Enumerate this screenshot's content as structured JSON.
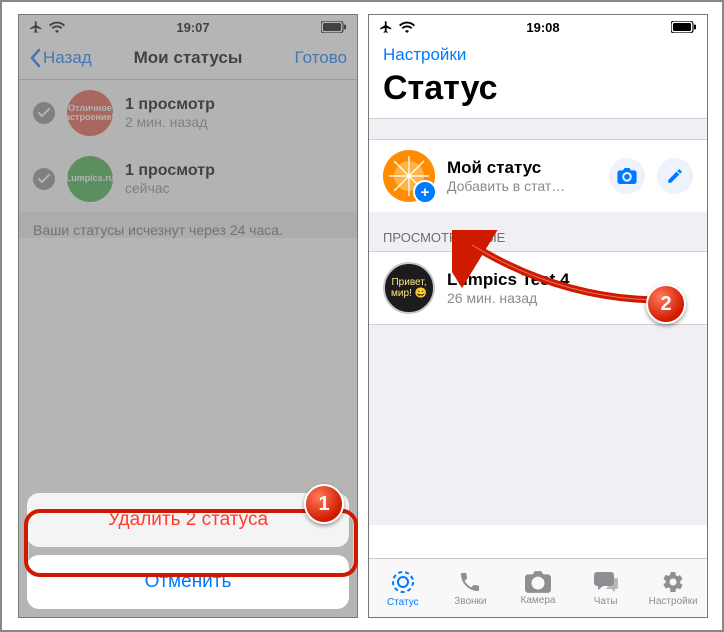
{
  "left": {
    "status_time": "19:07",
    "nav_back": "Назад",
    "nav_title": "Мои статусы",
    "nav_done": "Готово",
    "items": [
      {
        "thumb_label": "Отличное\nнастроение!!!",
        "title": "1 просмотр",
        "subtitle": "2 мин. назад"
      },
      {
        "thumb_label": "Lumpics.ru",
        "title": "1 просмотр",
        "subtitle": "сейчас"
      }
    ],
    "footer_note": "Ваши статусы исчезнут через 24 часа.",
    "sheet_delete": "Удалить 2 статуса",
    "sheet_cancel": "Отменить"
  },
  "right": {
    "status_time": "19:08",
    "settings_link": "Настройки",
    "page_title": "Статус",
    "my_status_title": "Мой статус",
    "my_status_sub": "Добавить в стат…",
    "plus_glyph": "+",
    "section_viewed": "ПРОСМОТРЕННЫЕ",
    "viewed_item": {
      "avatar_text": "Привет, мир! 😀",
      "title": "Lumpics Test 4",
      "subtitle": "26 мин. назад"
    },
    "tabs": {
      "status": "Статус",
      "calls": "Звонки",
      "camera": "Камера",
      "chats": "Чаты",
      "settings": "Настройки"
    }
  },
  "callouts": {
    "badge1": "1",
    "badge2": "2"
  }
}
